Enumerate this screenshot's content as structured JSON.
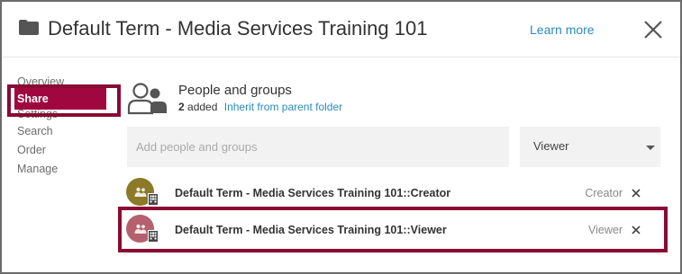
{
  "header": {
    "title": "Default Term - Media Services Training 101",
    "learn_more": "Learn more",
    "folder_icon": "folder-icon",
    "close_icon": "close-icon"
  },
  "sidebar": {
    "items": [
      {
        "label": "Overview",
        "active": false
      },
      {
        "label": "Share",
        "active": true
      },
      {
        "label": "Settings",
        "active": false
      },
      {
        "label": "Search",
        "active": false
      },
      {
        "label": "Order",
        "active": false
      },
      {
        "label": "Manage",
        "active": false
      }
    ]
  },
  "share": {
    "section_title": "People and groups",
    "added_count": "2",
    "added_suffix": "added",
    "inherit_link": "Inherit from parent folder",
    "add_placeholder": "Add people and groups",
    "role_select_value": "Viewer"
  },
  "members": [
    {
      "name": "Default Term - Media Services Training 101::Creator",
      "role": "Creator",
      "avatar_color": "#8c7a28"
    },
    {
      "name": "Default Term - Media Services Training 101::Viewer",
      "role": "Viewer",
      "avatar_color": "#b5606d"
    }
  ],
  "colors": {
    "accent": "#a0073e",
    "highlight_border": "#8a0a33",
    "link": "#2a8bbd"
  }
}
